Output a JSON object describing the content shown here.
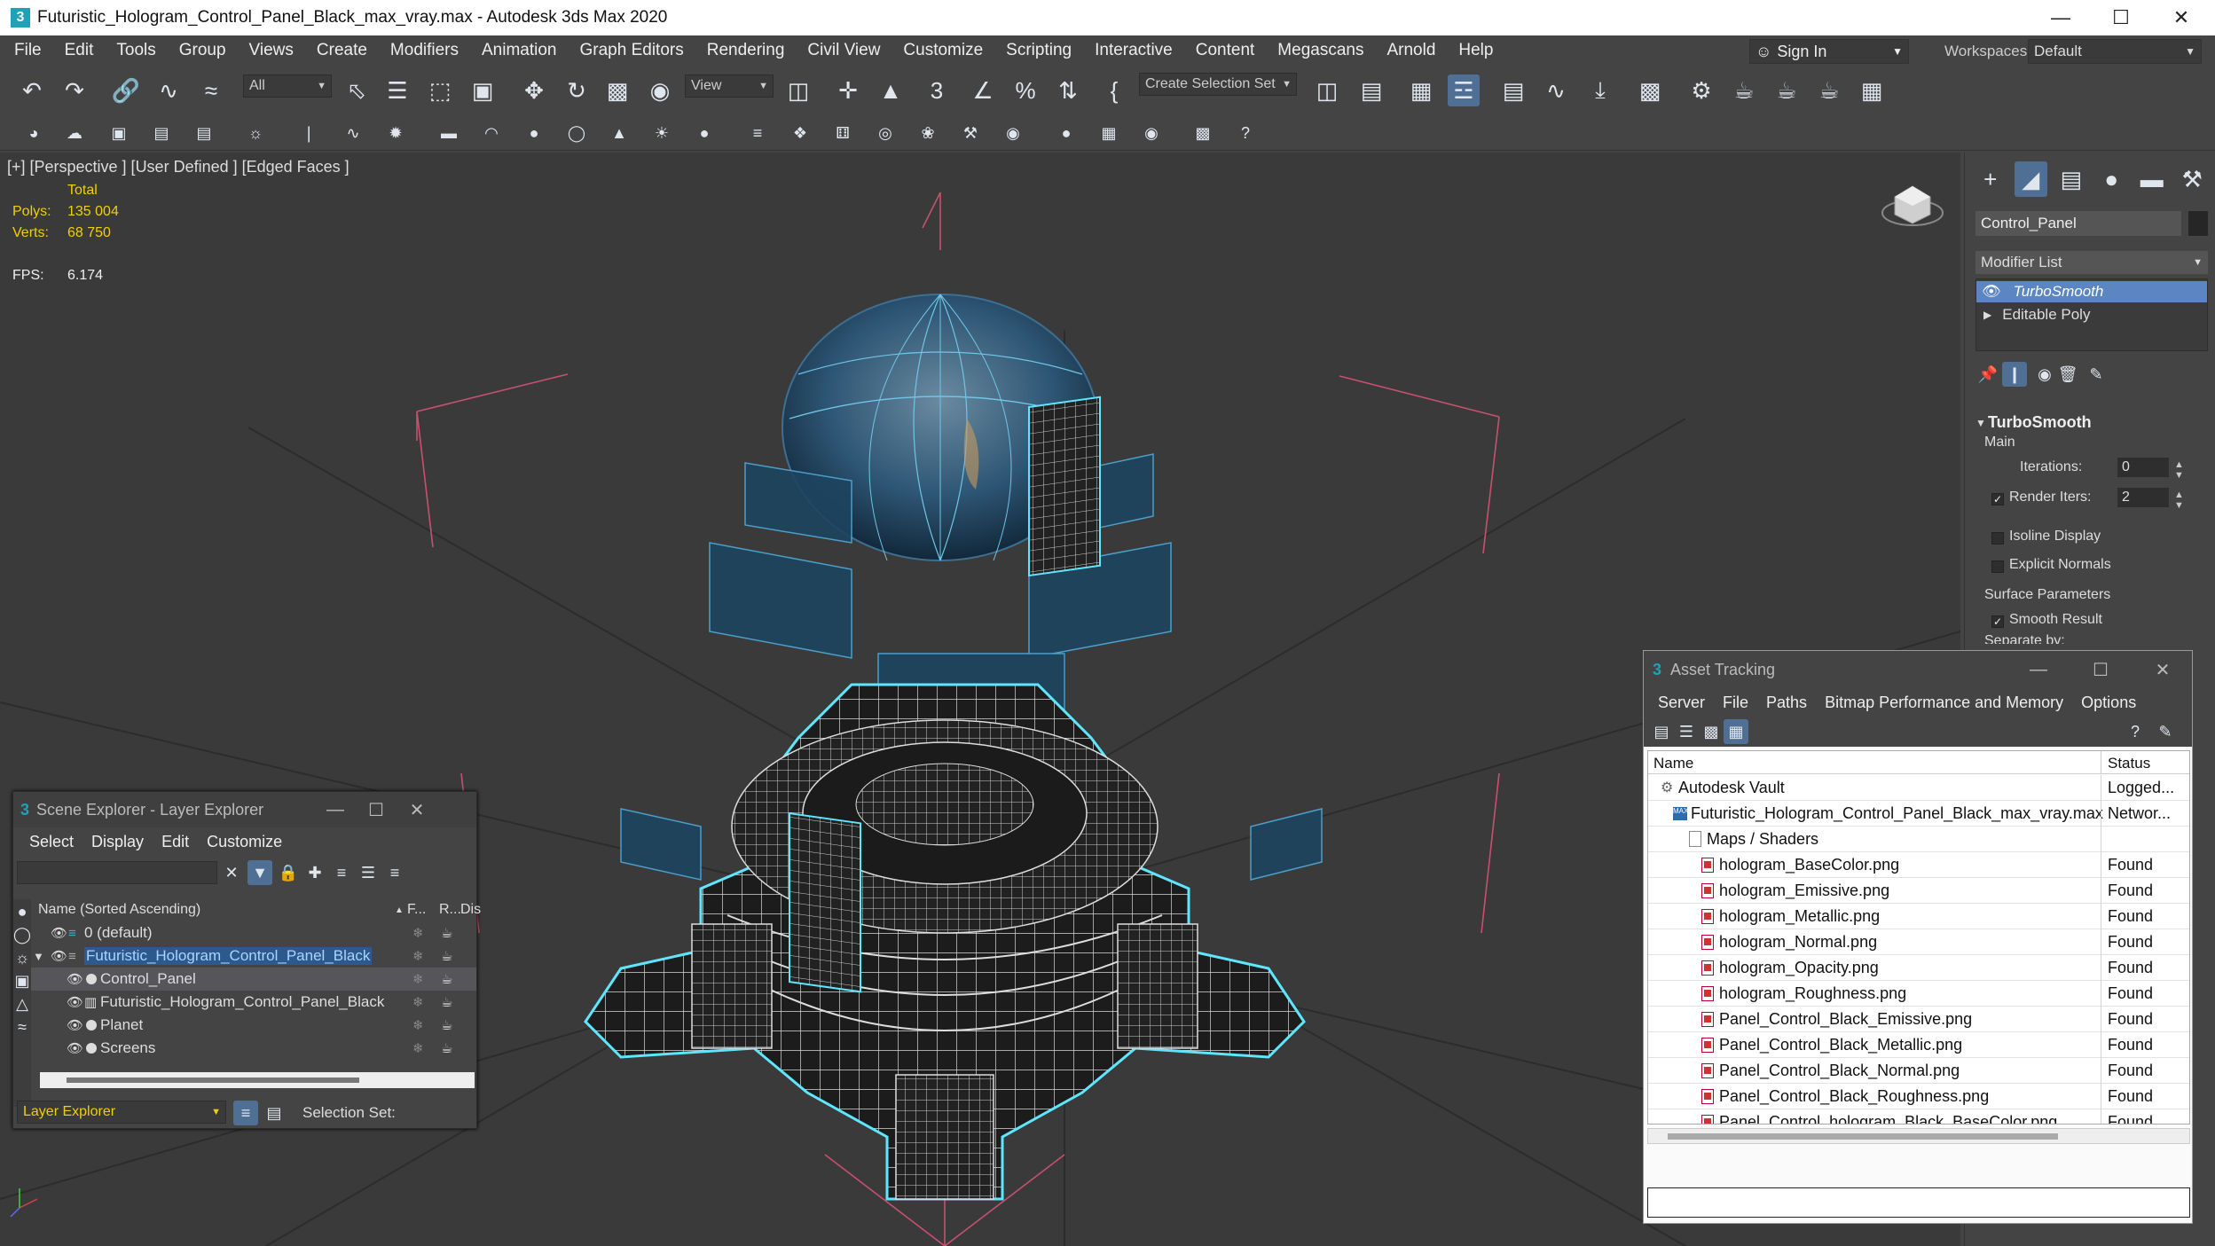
{
  "window": {
    "title": "Futuristic_Hologram_Control_Panel_Black_max_vray.max - Autodesk 3ds Max 2020",
    "app_icon_glyph": "3"
  },
  "menubar": {
    "items": [
      "File",
      "Edit",
      "Tools",
      "Group",
      "Views",
      "Create",
      "Modifiers",
      "Animation",
      "Graph Editors",
      "Rendering",
      "Civil View",
      "Customize",
      "Scripting",
      "Interactive",
      "Content",
      "Megascans",
      "Arnold",
      "Help"
    ],
    "signin": "Sign In",
    "workspaces_label": "Workspaces:",
    "workspace_value": "Default"
  },
  "toolbar": {
    "selection_filter": "All",
    "ref_coord": "View",
    "selection_set": "Create Selection Set"
  },
  "viewport": {
    "label": "[+] [Perspective ] [User Defined ] [Edged Faces ]",
    "stats_total": "Total",
    "polys_label": "Polys:",
    "polys_value": "135 004",
    "verts_label": "Verts:",
    "verts_value": "68 750",
    "fps_label": "FPS:",
    "fps_value": "6.174"
  },
  "command_panel": {
    "object_name": "Control_Panel",
    "modifier_list": "Modifier List",
    "stack": [
      "TurboSmooth",
      "Editable Poly"
    ],
    "rollout_title": "TurboSmooth",
    "main_label": "Main",
    "iterations_label": "Iterations:",
    "iterations_value": "0",
    "render_iters_label": "Render Iters:",
    "render_iters_value": "2",
    "render_iters_checked": true,
    "isoline_label": "Isoline Display",
    "explicit_normals_label": "Explicit Normals",
    "surface_params_label": "Surface Parameters",
    "smooth_result_label": "Smooth Result",
    "separate_by_label": "Separate by:"
  },
  "scene_explorer": {
    "title": "Scene Explorer - Layer Explorer",
    "menu": [
      "Select",
      "Display",
      "Edit",
      "Customize"
    ],
    "header_name": "Name (Sorted Ascending)",
    "header_f": "F...",
    "header_r": "R...",
    "header_dis": "Dis",
    "rows": [
      {
        "name": "0 (default)",
        "indent": 0
      },
      {
        "name": "Futuristic_Hologram_Control_Panel_Black",
        "indent": 0
      },
      {
        "name": "Control_Panel",
        "indent": 1
      },
      {
        "name": "Futuristic_Hologram_Control_Panel_Black",
        "indent": 1
      },
      {
        "name": "Planet",
        "indent": 1
      },
      {
        "name": "Screens",
        "indent": 1
      }
    ],
    "footer_explorer": "Layer Explorer",
    "footer_selection_set": "Selection Set:"
  },
  "asset_tracking": {
    "title": "Asset Tracking",
    "menu": [
      "Server",
      "File",
      "Paths",
      "Bitmap Performance and Memory",
      "Options"
    ],
    "col_name": "Name",
    "col_status": "Status",
    "rows": [
      {
        "name": "Autodesk Vault",
        "status": "Logged...",
        "level": 0,
        "kind": "vault"
      },
      {
        "name": "Futuristic_Hologram_Control_Panel_Black_max_vray.max",
        "status": "Networ...",
        "level": 1,
        "kind": "max"
      },
      {
        "name": "Maps / Shaders",
        "status": "",
        "level": 2,
        "kind": "folder"
      },
      {
        "name": "hologram_BaseColor.png",
        "status": "Found",
        "level": 3,
        "kind": "file"
      },
      {
        "name": "hologram_Emissive.png",
        "status": "Found",
        "level": 3,
        "kind": "file"
      },
      {
        "name": "hologram_Metallic.png",
        "status": "Found",
        "level": 3,
        "kind": "file"
      },
      {
        "name": "hologram_Normal.png",
        "status": "Found",
        "level": 3,
        "kind": "file"
      },
      {
        "name": "hologram_Opacity.png",
        "status": "Found",
        "level": 3,
        "kind": "file"
      },
      {
        "name": "hologram_Roughness.png",
        "status": "Found",
        "level": 3,
        "kind": "file"
      },
      {
        "name": "Panel_Control_Black_Emissive.png",
        "status": "Found",
        "level": 3,
        "kind": "file"
      },
      {
        "name": "Panel_Control_Black_Metallic.png",
        "status": "Found",
        "level": 3,
        "kind": "file"
      },
      {
        "name": "Panel_Control_Black_Normal.png",
        "status": "Found",
        "level": 3,
        "kind": "file"
      },
      {
        "name": "Panel_Control_Black_Roughness.png",
        "status": "Found",
        "level": 3,
        "kind": "file"
      },
      {
        "name": "Panel_Control_hologram_Black_BaseColor.png",
        "status": "Found",
        "level": 3,
        "kind": "file"
      }
    ]
  },
  "colors": {
    "accent": "#5b86c1",
    "selection_cyan": "#5fe6ff",
    "stats_yellow": "#f0d000",
    "bbox_pink": "#c8506e"
  }
}
